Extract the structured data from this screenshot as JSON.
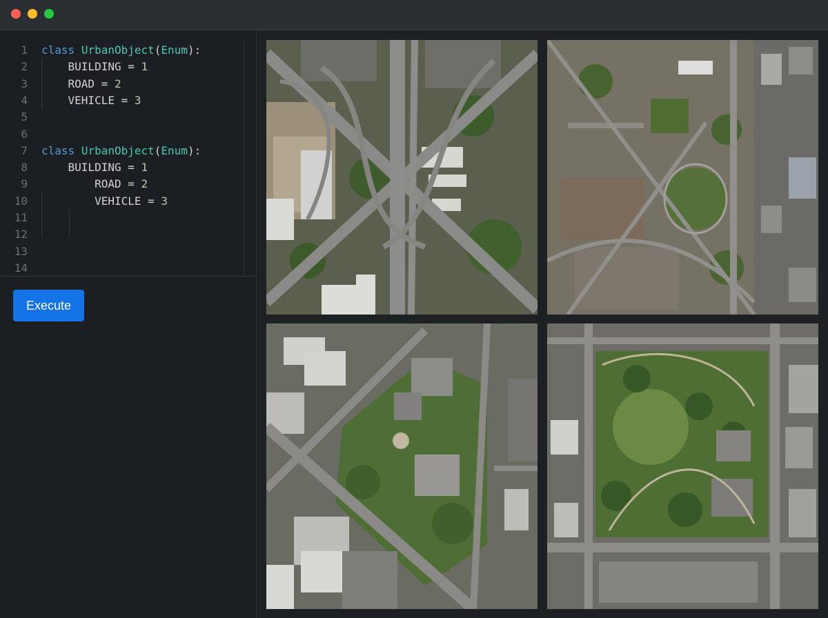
{
  "editor": {
    "lines": [
      {
        "n": "1",
        "kw": "class",
        "name": "UrbanObject",
        "base": "Enum"
      },
      {
        "n": "2",
        "member": "BUILDING",
        "eq": " = ",
        "val": "1"
      },
      {
        "n": "3",
        "member": "ROAD",
        "eq": " = ",
        "val": "2"
      },
      {
        "n": "4",
        "member": "VEHICLE",
        "eq": " = ",
        "val": "3"
      },
      {
        "n": "5"
      },
      {
        "n": "6"
      },
      {
        "n": "7",
        "kw": "class",
        "name": "UrbanObject",
        "base": "Enum"
      },
      {
        "n": "8",
        "member": "BUILDING",
        "eq": " = ",
        "val": "1"
      },
      {
        "n": "9",
        "member": "ROAD",
        "eq": " = ",
        "val": "2"
      },
      {
        "n": "10",
        "member": "VEHICLE",
        "eq": " = ",
        "val": "3"
      },
      {
        "n": "11"
      },
      {
        "n": "12"
      },
      {
        "n": "13"
      },
      {
        "n": "14"
      }
    ],
    "syntax_colors": {
      "keyword": "#569cd6",
      "class_name": "#4ec9b0",
      "number": "#b5cea8",
      "text": "#d4d4d4",
      "line_number": "#6b7078"
    }
  },
  "toolbar": {
    "execute_label": "Execute",
    "execute_color": "#1473e6"
  },
  "image_grid": {
    "tiles": [
      {
        "id": "tile-1",
        "scene": "highway-interchange-aerial"
      },
      {
        "id": "tile-2",
        "scene": "residential-neighborhood-aerial"
      },
      {
        "id": "tile-3",
        "scene": "urban-campus-aerial"
      },
      {
        "id": "tile-4",
        "scene": "city-park-aerial"
      }
    ]
  },
  "window_controls": {
    "close_color": "#ff5f57",
    "minimize_color": "#febc2e",
    "maximize_color": "#28c840"
  }
}
